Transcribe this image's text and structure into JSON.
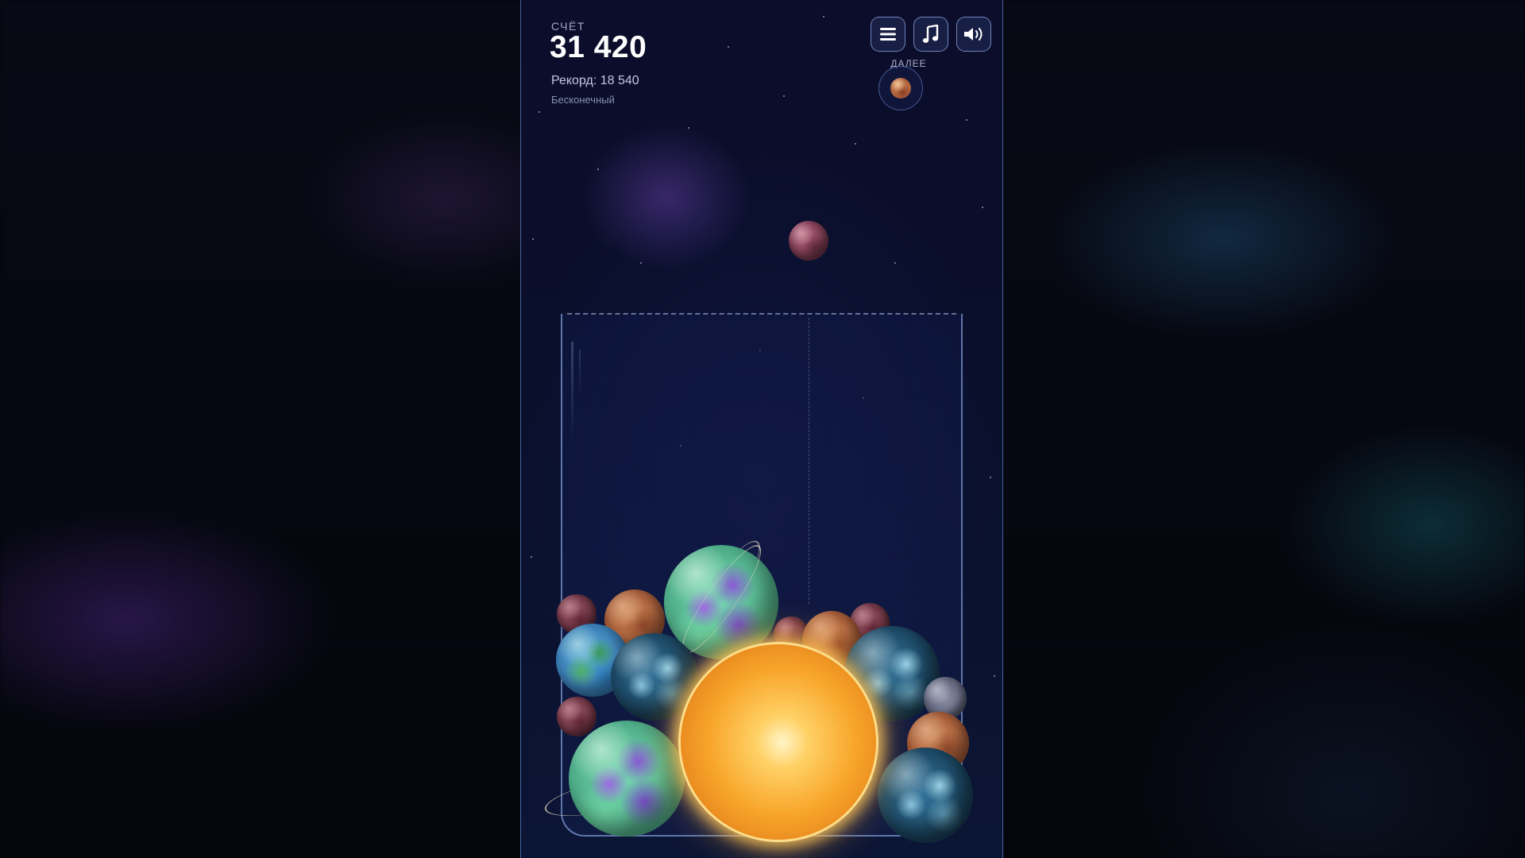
{
  "hud": {
    "score_label": "СЧЁТ",
    "score_value": "31 420",
    "record_text": "Рекорд: 18 540",
    "mode_text": "Бесконечный",
    "next_label": "ДАЛЕЕ"
  },
  "toolbar": {
    "menu_icon": "menu-icon",
    "music_icon": "music-note-icon",
    "sound_icon": "speaker-icon"
  },
  "next_planet": "mars",
  "dropping_planet": "rose",
  "colors": {
    "panel_border": "#78aaff",
    "container_border": "#8caae6",
    "background": "#05060d",
    "sun": "#f8a62b"
  }
}
